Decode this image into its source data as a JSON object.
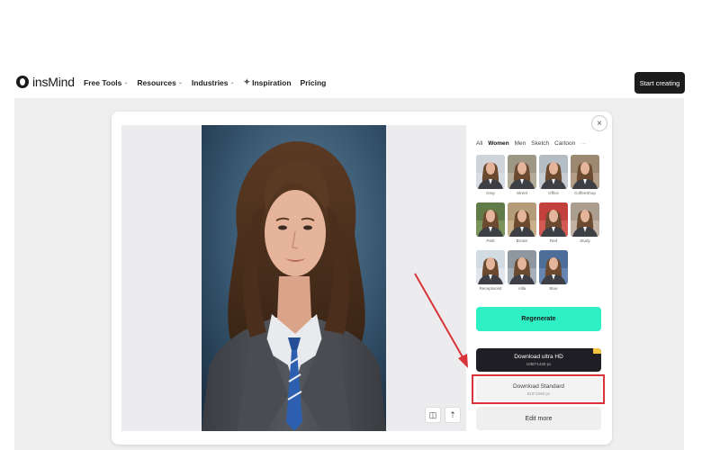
{
  "brand": {
    "name": "insMind"
  },
  "nav": {
    "items": [
      {
        "label": "Free Tools",
        "has_caret": true
      },
      {
        "label": "Resources",
        "has_caret": true
      },
      {
        "label": "Industries",
        "has_caret": true
      },
      {
        "label": "Inspiration",
        "icon": "sparkle-icon"
      },
      {
        "label": "Pricing"
      }
    ],
    "cta_label": "Start creating"
  },
  "modal": {
    "close_symbol": "×",
    "filters": {
      "tabs": [
        "All",
        "Women",
        "Men",
        "Sketch",
        "Cartoon"
      ],
      "active": "Women",
      "more_symbol": "···"
    },
    "styles": [
      {
        "label": "Gray"
      },
      {
        "label": "Street"
      },
      {
        "label": "Office"
      },
      {
        "label": "CoffeeShop"
      },
      {
        "label": "Park"
      },
      {
        "label": "Brown"
      },
      {
        "label": "Red"
      },
      {
        "label": "Study"
      },
      {
        "label": "Receptionist"
      },
      {
        "label": "Villa"
      },
      {
        "label": "Blue"
      }
    ],
    "regenerate_label": "Regenerate",
    "download_ultra": {
      "label": "Download ultra HD",
      "size": "1080*1440 px"
    },
    "download_standard": {
      "label": "Download Standard",
      "size": "810*1080 px"
    },
    "edit_more_label": "Edit more",
    "preview_tools": {
      "compare_symbol": "◫",
      "share_symbol": "⇡"
    }
  },
  "colors": {
    "accent": "#2ff0c5",
    "dark_button": "#1e1e24",
    "highlight_border": "#d9343a",
    "arrow": "#d9343a"
  }
}
